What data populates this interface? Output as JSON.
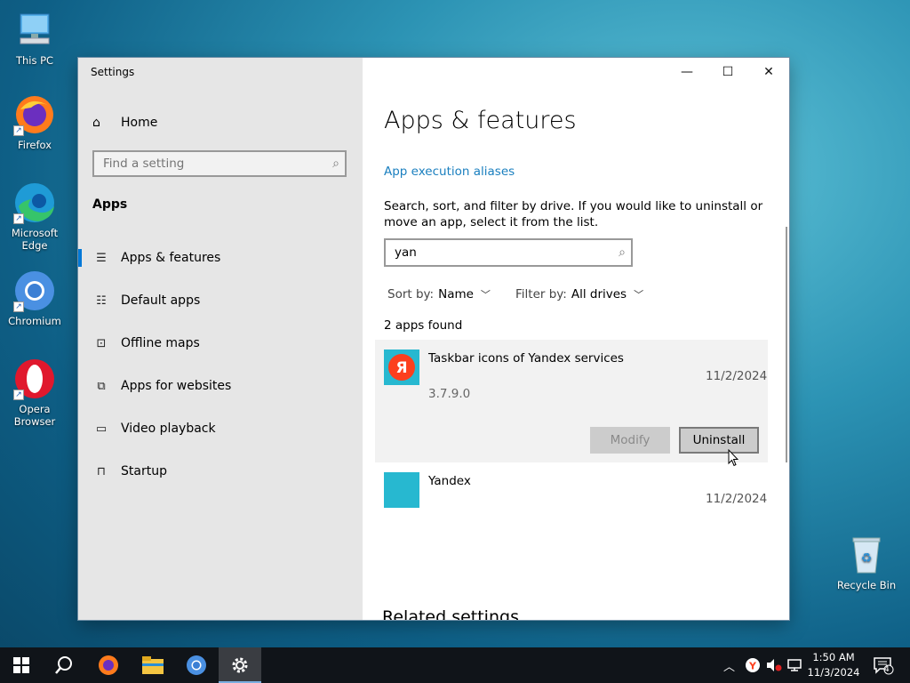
{
  "desktop": {
    "icons": [
      {
        "label": "This PC"
      },
      {
        "label": "Firefox"
      },
      {
        "label": "Microsoft Edge"
      },
      {
        "label": "Chromium"
      },
      {
        "label": "Opera Browser"
      },
      {
        "label": "Recycle Bin"
      }
    ]
  },
  "window": {
    "title": "Settings",
    "controls": {
      "minimize": "—",
      "maximize": "☐",
      "close": "✕"
    }
  },
  "sidebar": {
    "home_label": "Home",
    "search_placeholder": "Find a setting",
    "section": "Apps",
    "items": [
      {
        "label": "Apps & features",
        "icon": "apps-features-icon",
        "active": true
      },
      {
        "label": "Default apps",
        "icon": "default-apps-icon"
      },
      {
        "label": "Offline maps",
        "icon": "offline-maps-icon"
      },
      {
        "label": "Apps for websites",
        "icon": "apps-websites-icon"
      },
      {
        "label": "Video playback",
        "icon": "video-playback-icon"
      },
      {
        "label": "Startup",
        "icon": "startup-icon"
      }
    ]
  },
  "main": {
    "title": "Apps & features",
    "aliases_link": "App execution aliases",
    "description": "Search, sort, and filter by drive. If you would like to uninstall or move an app, select it from the list.",
    "search_value": "yan",
    "sort_label": "Sort by:",
    "sort_value": "Name",
    "filter_label": "Filter by:",
    "filter_value": "All drives",
    "count_text": "2 apps found",
    "apps": [
      {
        "name": "Taskbar icons of Yandex services",
        "date": "11/2/2024",
        "version": "3.7.9.0",
        "icon_letter": "Я"
      },
      {
        "name": "Yandex",
        "date": "11/2/2024"
      }
    ],
    "modify_label": "Modify",
    "uninstall_label": "Uninstall",
    "related_heading": "Related settings"
  },
  "taskbar": {
    "time": "1:50 AM",
    "date": "11/3/2024",
    "notification_count": "4"
  },
  "colors": {
    "accent": "#0078d7",
    "link": "#1a7fbf",
    "yandex_red": "#fc3f1d",
    "yandex_tile": "#27b8d0"
  }
}
